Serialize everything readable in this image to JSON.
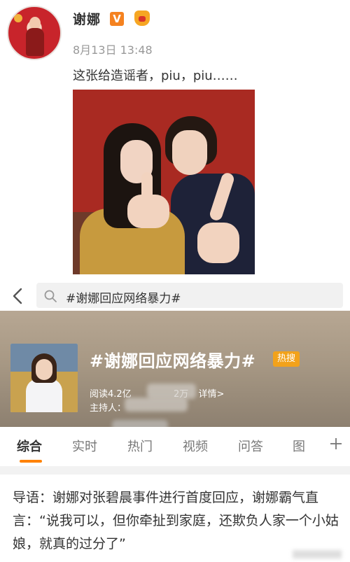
{
  "post": {
    "username": "谢娜",
    "verified_badge": "V",
    "timestamp": "8月13日 13:48",
    "text": "这张给造谣者，piu，piu……"
  },
  "search": {
    "query": "#谢娜回应网络暴力#"
  },
  "topic": {
    "title": "#谢娜回应网络暴力#",
    "hot_badge": "热搜",
    "reads_label": "阅读4.2亿",
    "discussion_count": "2万",
    "details_link": "详情>",
    "host_label": "主持人："
  },
  "tabs": [
    {
      "label": "综合",
      "active": true
    },
    {
      "label": "实时",
      "active": false
    },
    {
      "label": "热门",
      "active": false
    },
    {
      "label": "视频",
      "active": false
    },
    {
      "label": "问答",
      "active": false
    },
    {
      "label": "图",
      "active": false
    }
  ],
  "intro": {
    "text": "导语：谢娜对张碧晨事件进行首度回应，谢娜霸气直言：“说我可以，但你牵扯到家庭，还欺负人家一个小姑娘，就真的过分了”"
  },
  "colors": {
    "accent": "#ff8200",
    "verified": "#f58220",
    "hot_badge": "#f2a21b"
  }
}
